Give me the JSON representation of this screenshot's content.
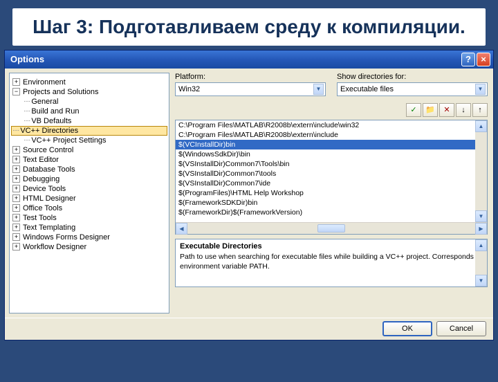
{
  "slide": {
    "title": "Шаг 3: Подготавливаем среду к компиляции."
  },
  "dialog": {
    "title": "Options",
    "help": "?",
    "close": "×"
  },
  "tree": [
    {
      "label": "Environment",
      "exp": "+",
      "depth": 0
    },
    {
      "label": "Projects and Solutions",
      "exp": "−",
      "depth": 0
    },
    {
      "label": "General",
      "depth": 1
    },
    {
      "label": "Build and Run",
      "depth": 1
    },
    {
      "label": "VB Defaults",
      "depth": 1
    },
    {
      "label": "VC++ Directories",
      "depth": 1,
      "sel": true
    },
    {
      "label": "VC++ Project Settings",
      "depth": 1
    },
    {
      "label": "Source Control",
      "exp": "+",
      "depth": 0
    },
    {
      "label": "Text Editor",
      "exp": "+",
      "depth": 0
    },
    {
      "label": "Database Tools",
      "exp": "+",
      "depth": 0
    },
    {
      "label": "Debugging",
      "exp": "+",
      "depth": 0
    },
    {
      "label": "Device Tools",
      "exp": "+",
      "depth": 0
    },
    {
      "label": "HTML Designer",
      "exp": "+",
      "depth": 0
    },
    {
      "label": "Office Tools",
      "exp": "+",
      "depth": 0
    },
    {
      "label": "Test Tools",
      "exp": "+",
      "depth": 0
    },
    {
      "label": "Text Templating",
      "exp": "+",
      "depth": 0
    },
    {
      "label": "Windows Forms Designer",
      "exp": "+",
      "depth": 0
    },
    {
      "label": "Workflow Designer",
      "exp": "+",
      "depth": 0
    }
  ],
  "platform": {
    "label": "Platform:",
    "value": "Win32"
  },
  "showdir": {
    "label": "Show directories for:",
    "value": "Executable files"
  },
  "toolbar": {
    "check": "✓",
    "new": "📁",
    "delete": "✕",
    "down": "↓",
    "up": "↑"
  },
  "paths": [
    {
      "text": "C:\\Program Files\\MATLAB\\R2008b\\extern\\include\\win32"
    },
    {
      "text": "C:\\Program Files\\MATLAB\\R2008b\\extern\\include"
    },
    {
      "text": "$(VCInstallDir)bin",
      "sel": true
    },
    {
      "text": "$(WindowsSdkDir)\\bin"
    },
    {
      "text": "$(VSInstallDir)Common7\\Tools\\bin"
    },
    {
      "text": "$(VSInstallDir)Common7\\tools"
    },
    {
      "text": "$(VSInstallDir)Common7\\ide"
    },
    {
      "text": "$(ProgramFiles)\\HTML Help Workshop"
    },
    {
      "text": "$(FrameworkSDKDir)bin"
    },
    {
      "text": "$(FrameworkDir)$(FrameworkVersion)"
    }
  ],
  "desc": {
    "title": "Executable Directories",
    "text": "Path to use when searching for executable files while building a VC++ project.  Corresponds to environment variable PATH."
  },
  "buttons": {
    "ok": "OK",
    "cancel": "Cancel"
  }
}
